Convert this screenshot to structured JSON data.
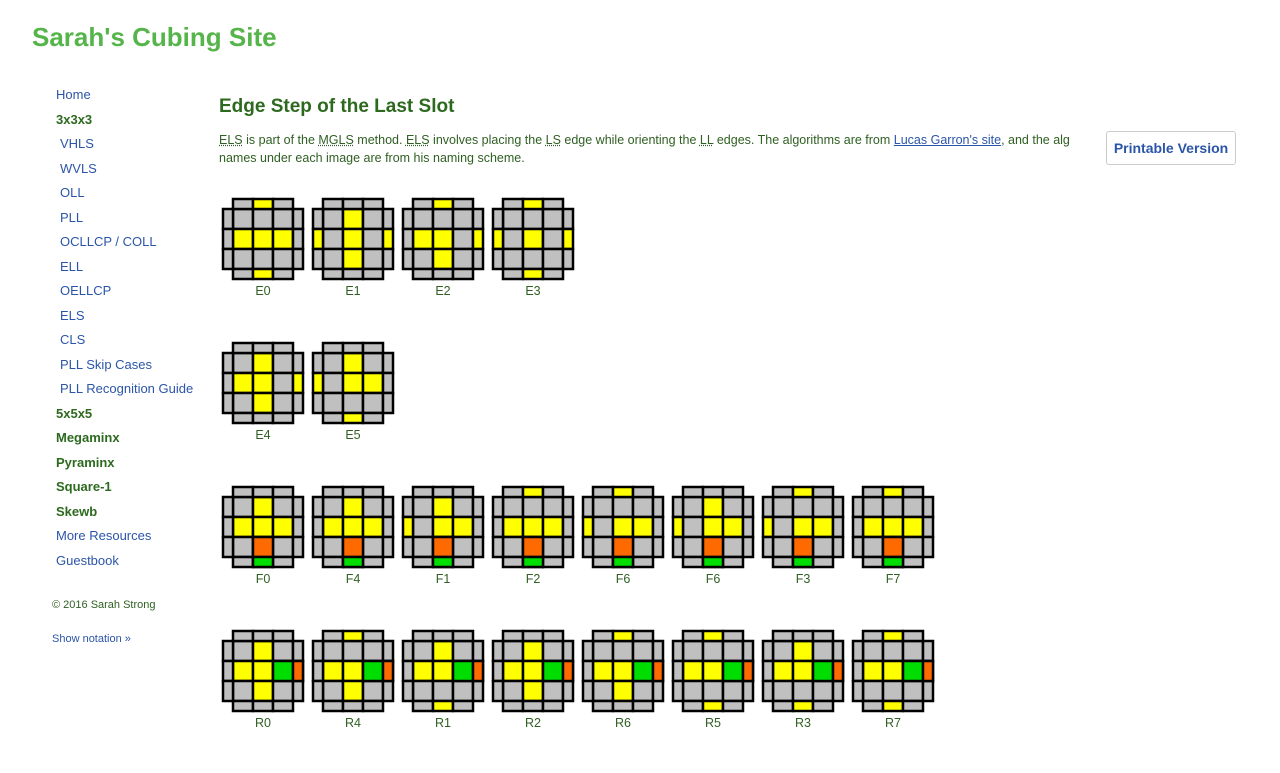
{
  "colors": {
    "site_title": "#55b44a",
    "heading": "#2d6a1f",
    "text": "#2f5f22",
    "link": "#2b55a8",
    "sticker_gray": "#c0c0c0",
    "sticker_yellow": "#ffff00",
    "sticker_orange": "#ff6a00",
    "sticker_green": "#00dd00",
    "sticker_border": "#000000"
  },
  "site_title": "Sarah's Cubing Site",
  "sidebar": {
    "items": [
      {
        "label": "Home",
        "kind": "top link"
      },
      {
        "label": "3x3x3",
        "kind": "top strong"
      },
      {
        "label": "VHLS",
        "kind": "sub link"
      },
      {
        "label": "WVLS",
        "kind": "sub link"
      },
      {
        "label": "OLL",
        "kind": "sub link"
      },
      {
        "label": "PLL",
        "kind": "sub link"
      },
      {
        "label": "OCLLCP / COLL",
        "kind": "sub link"
      },
      {
        "label": "ELL",
        "kind": "sub link"
      },
      {
        "label": "OELLCP",
        "kind": "sub link"
      },
      {
        "label": "ELS",
        "kind": "sub link"
      },
      {
        "label": "CLS",
        "kind": "sub link"
      },
      {
        "label": "PLL Skip Cases",
        "kind": "sub link"
      },
      {
        "label": "PLL Recognition Guide",
        "kind": "sub link"
      },
      {
        "label": "5x5x5",
        "kind": "top strong"
      },
      {
        "label": "Megaminx",
        "kind": "top strong"
      },
      {
        "label": "Pyraminx",
        "kind": "top strong"
      },
      {
        "label": "Square-1",
        "kind": "top strong"
      },
      {
        "label": "Skewb",
        "kind": "top strong"
      },
      {
        "label": "More Resources",
        "kind": "top link"
      },
      {
        "label": "Guestbook",
        "kind": "top link"
      }
    ],
    "copyright": "© 2016 Sarah Strong",
    "show_notation": "Show notation »"
  },
  "main": {
    "title": "Edge Step of the Last Slot",
    "intro": {
      "abbr_els": "ELS",
      "t1": " is part of the ",
      "abbr_mgls": "MGLS",
      "t2": " method. ",
      "abbr_els2": "ELS",
      "t3": " involves placing the ",
      "abbr_ls": "LS",
      "t4": " edge while orienting the ",
      "abbr_ll": "LL",
      "t5": " edges. The algorithms are from ",
      "link": "Lucas Garron's site",
      "t6": ", and the alg names under each image are from his naming scheme."
    },
    "printable_button": "Printable Version"
  },
  "case_rows": [
    [
      {
        "name": "E0",
        "flips": [
          1,
          0,
          0,
          1
        ],
        "slot": "none"
      },
      {
        "name": "E1",
        "flips": [
          0,
          1,
          1,
          0
        ],
        "slot": "none"
      },
      {
        "name": "E2",
        "flips": [
          1,
          0,
          1,
          0
        ],
        "slot": "none"
      },
      {
        "name": "E3",
        "flips": [
          1,
          1,
          1,
          1
        ],
        "slot": "none"
      }
    ],
    [
      {
        "name": "E4",
        "flips": [
          0,
          0,
          1,
          0
        ],
        "slot": "none"
      },
      {
        "name": "E5",
        "flips": [
          0,
          1,
          0,
          1
        ],
        "slot": "none"
      }
    ],
    [
      {
        "name": "F0",
        "flips": [
          0,
          0,
          0,
          0
        ],
        "slot": "front"
      },
      {
        "name": "F4",
        "flips": [
          0,
          0,
          0,
          1
        ],
        "slot": "front"
      },
      {
        "name": "F1",
        "flips": [
          0,
          1,
          0,
          0
        ],
        "slot": "front"
      },
      {
        "name": "F2",
        "flips": [
          1,
          0,
          0,
          0
        ],
        "slot": "front"
      },
      {
        "name": "F6",
        "flips": [
          1,
          1,
          0,
          1
        ],
        "slot": "front"
      },
      {
        "name": "F6",
        "flips": [
          0,
          1,
          0,
          1
        ],
        "slot": "front"
      },
      {
        "name": "F3",
        "flips": [
          1,
          1,
          0,
          1
        ],
        "slot": "front"
      },
      {
        "name": "F7",
        "flips": [
          1,
          0,
          0,
          1
        ],
        "slot": "front"
      }
    ],
    [
      {
        "name": "R0",
        "flips": [
          0,
          0,
          1,
          0
        ],
        "slot": "right"
      },
      {
        "name": "R4",
        "flips": [
          1,
          0,
          0,
          0
        ],
        "slot": "right"
      },
      {
        "name": "R1",
        "flips": [
          0,
          0,
          0,
          1
        ],
        "slot": "right"
      },
      {
        "name": "R2",
        "flips": [
          0,
          0,
          1,
          0
        ],
        "slot": "right"
      },
      {
        "name": "R6",
        "flips": [
          1,
          0,
          1,
          0
        ],
        "slot": "right"
      },
      {
        "name": "R5",
        "flips": [
          1,
          0,
          1,
          1
        ],
        "slot": "right"
      },
      {
        "name": "R3",
        "flips": [
          0,
          0,
          0,
          1
        ],
        "slot": "right"
      },
      {
        "name": "R7",
        "flips": [
          1,
          0,
          0,
          1
        ],
        "slot": "right"
      }
    ]
  ]
}
